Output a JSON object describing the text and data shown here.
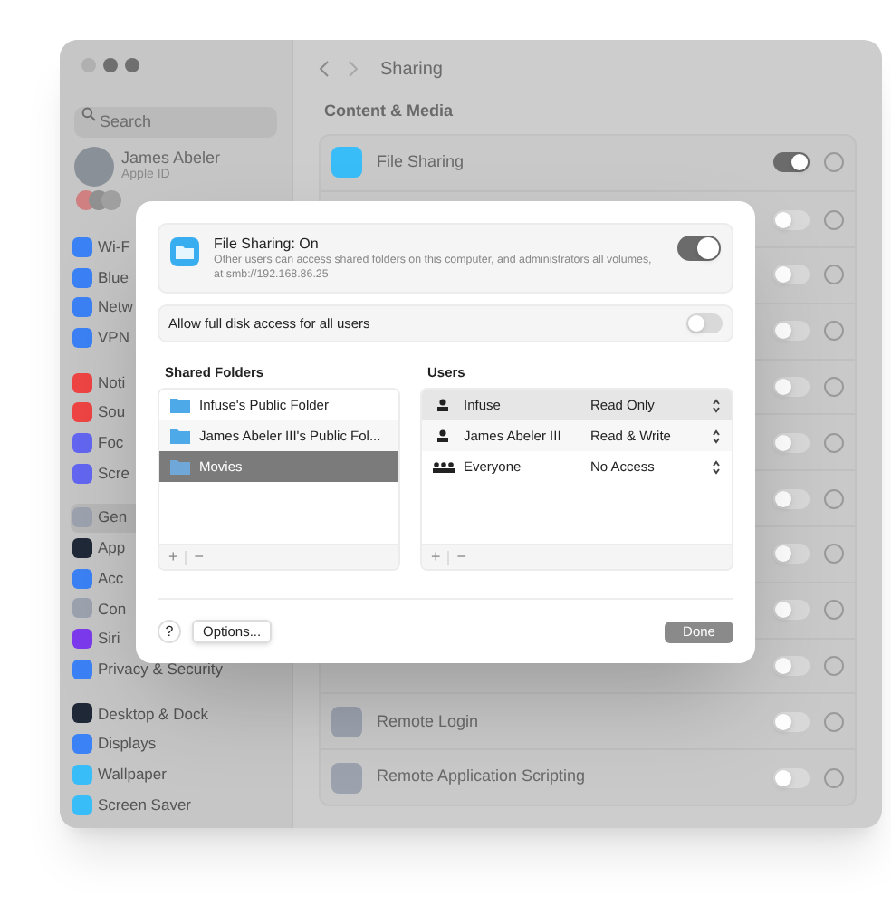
{
  "sidebar": {
    "search": {
      "placeholder": "Search"
    },
    "account": {
      "name": "James Abeler",
      "subtitle": "Apple ID"
    },
    "groups": [
      [
        {
          "label": "Wi-F",
          "color": "#3b82f6",
          "selected": false
        },
        {
          "label": "Blue",
          "color": "#3b82f6",
          "selected": false
        },
        {
          "label": "Netw",
          "color": "#3b82f6",
          "selected": false
        },
        {
          "label": "VPN",
          "color": "#3b82f6",
          "selected": false
        }
      ],
      [
        {
          "label": "Noti",
          "color": "#ef4444",
          "selected": false
        },
        {
          "label": "Sou",
          "color": "#ef4444",
          "selected": false
        },
        {
          "label": "Foc",
          "color": "#6366f1",
          "selected": false
        },
        {
          "label": "Scre",
          "color": "#6366f1",
          "selected": false
        }
      ],
      [
        {
          "label": "Gen",
          "color": "#9ca3af",
          "selected": true
        },
        {
          "label": "App",
          "color": "#1f2937",
          "selected": false
        },
        {
          "label": "Acc",
          "color": "#3b82f6",
          "selected": false
        },
        {
          "label": "Con",
          "color": "#9ca3af",
          "selected": false
        },
        {
          "label": "Siri",
          "color": "#7c3aed",
          "selected": false
        },
        {
          "label": "Privacy & Security",
          "color": "#3b82f6",
          "selected": false
        }
      ],
      [
        {
          "label": "Desktop & Dock",
          "color": "#1f2937",
          "selected": false
        },
        {
          "label": "Displays",
          "color": "#3b82f6",
          "selected": false
        },
        {
          "label": "Wallpaper",
          "color": "#38bdf8",
          "selected": false
        },
        {
          "label": "Screen Saver",
          "color": "#38bdf8",
          "selected": false
        }
      ]
    ]
  },
  "main": {
    "title": "Sharing",
    "section": "Content & Media",
    "rows": [
      {
        "label": "File Sharing",
        "on": true,
        "color": "#38bdf8"
      },
      {
        "on": false
      },
      {
        "on": false
      },
      {
        "on": false
      },
      {
        "on": false
      },
      {
        "on": false
      },
      {
        "on": false
      },
      {
        "on": false
      },
      {
        "on": false
      },
      {
        "on": false
      },
      {
        "label": "Remote Login",
        "on": false,
        "color": "#9ca3af"
      },
      {
        "label": "Remote Application Scripting",
        "on": false,
        "color": "#9ca3af"
      }
    ]
  },
  "sheet": {
    "service": {
      "title": "File Sharing: On",
      "description": "Other users can access shared folders on this computer, and administrators all volumes, at smb://192.168.86.25",
      "on": true
    },
    "full_disk": {
      "label": "Allow full disk access for all users",
      "on": false
    },
    "folders": {
      "title": "Shared Folders",
      "items": [
        {
          "name": "Infuse's Public Folder",
          "selected": false
        },
        {
          "name": "James Abeler III's Public Fol...",
          "selected": false
        },
        {
          "name": "Movies",
          "selected": true
        }
      ],
      "add": "+",
      "remove": "−"
    },
    "users": {
      "title": "Users",
      "items": [
        {
          "name": "Infuse",
          "kind": "user",
          "access": "Read Only",
          "selected": true
        },
        {
          "name": "James Abeler III",
          "kind": "user",
          "access": "Read & Write",
          "selected": false
        },
        {
          "name": "Everyone",
          "kind": "group",
          "access": "No Access",
          "selected": false
        }
      ],
      "add": "+",
      "remove": "−"
    },
    "help": "?",
    "options": "Options...",
    "done": "Done"
  }
}
